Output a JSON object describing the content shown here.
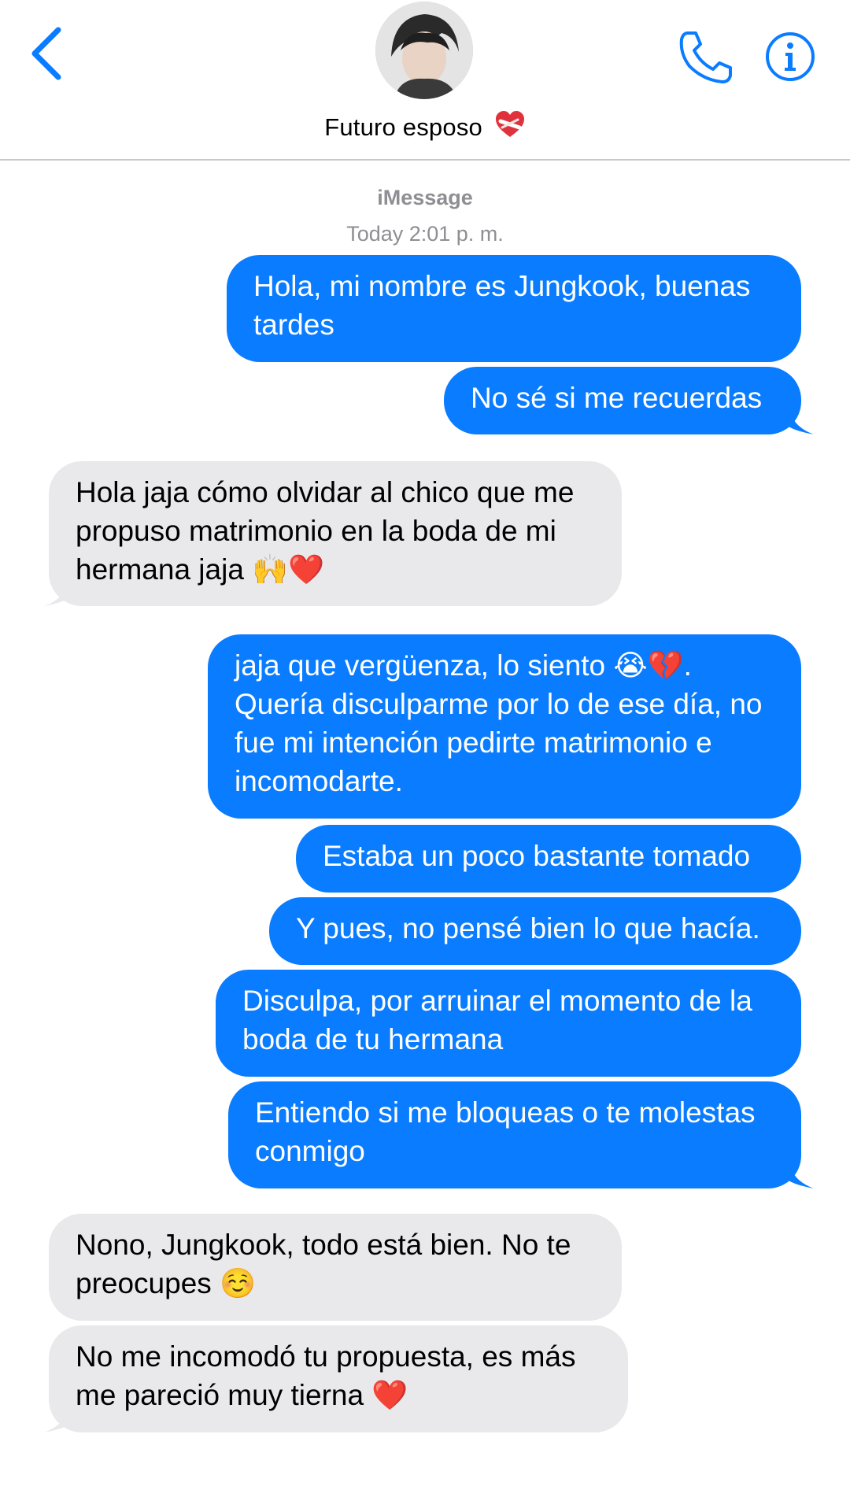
{
  "header": {
    "back_icon": "chevron-left-icon",
    "contact_name": "Futuro esposo",
    "contact_emoji": "❤️‍🩹",
    "call_icon": "phone-icon",
    "info_icon": "info-icon",
    "accent_color": "#0a7cff"
  },
  "conversation": {
    "service": "iMessage",
    "timestamp": "Today 2:01 p. m.",
    "messages": [
      {
        "from": "me",
        "text": "Hola, mi nombre es Jungkook, buenas tardes"
      },
      {
        "from": "me",
        "text": "No sé si me recuerdas"
      },
      {
        "from": "them",
        "text": "Hola jaja cómo olvidar al chico que me propuso matrimonio en la boda de mi hermana jaja 🙌❤️"
      },
      {
        "from": "me",
        "text": "jaja que vergüenza, lo siento 😭💔. Quería disculparme por lo de ese día, no fue mi intención pedirte matrimonio e incomodarte."
      },
      {
        "from": "me",
        "text": "Estaba un poco bastante tomado"
      },
      {
        "from": "me",
        "text": "Y pues, no pensé bien lo que hacía."
      },
      {
        "from": "me",
        "text": "Disculpa, por arruinar el momento de la boda de tu hermana"
      },
      {
        "from": "me",
        "text": "Entiendo si me bloqueas o te molestas conmigo"
      },
      {
        "from": "them",
        "text": "Nono, Jungkook, todo está bien. No te preocupes ☺️"
      },
      {
        "from": "them",
        "text": "No me incomodó tu propuesta, es más me pareció muy tierna ❤️"
      }
    ]
  },
  "colors": {
    "outgoing_bubble": "#0a7cff",
    "incoming_bubble": "#e9e9eb",
    "meta_text": "#8e8e93"
  }
}
